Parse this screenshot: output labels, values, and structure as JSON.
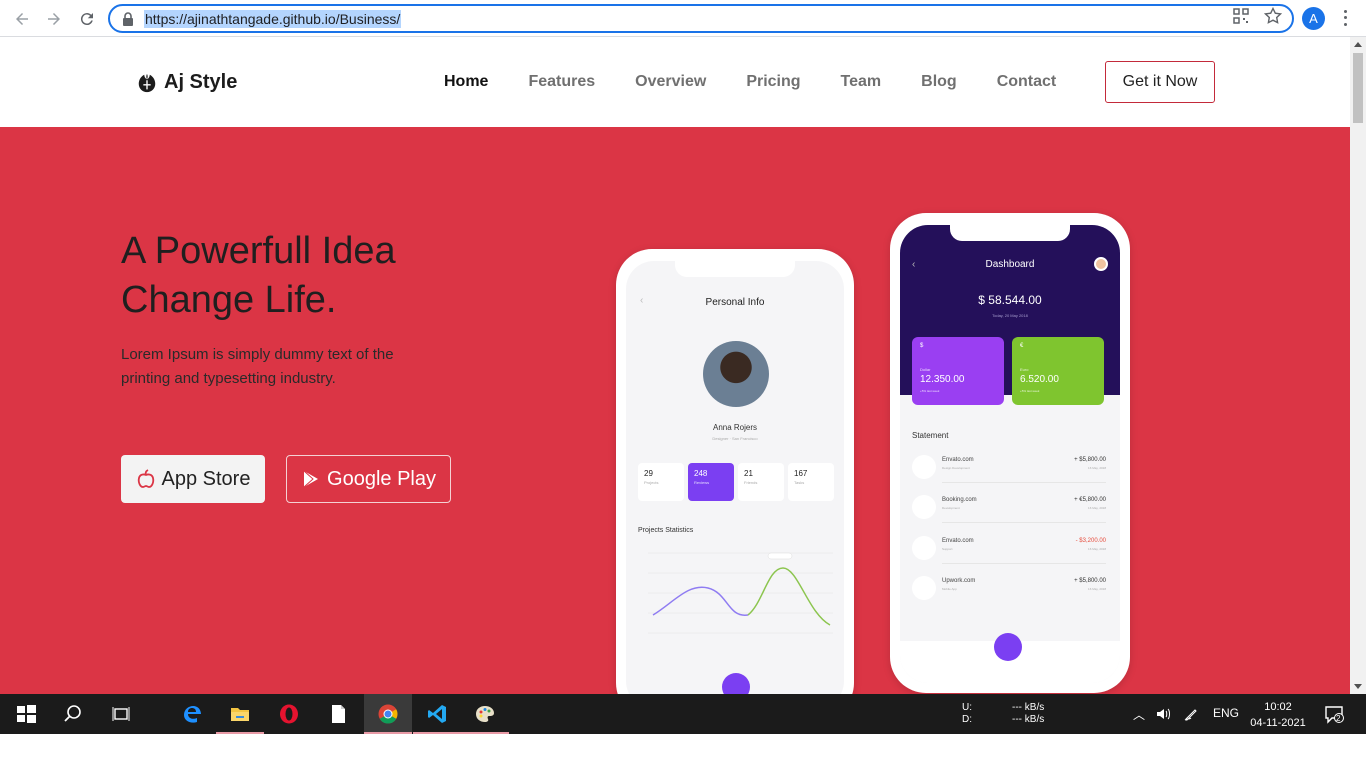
{
  "browser": {
    "url": "https://ajinathtangade.github.io/Business/",
    "profile_initial": "A"
  },
  "site": {
    "brand": "Aj Style",
    "menu": [
      "Home",
      "Features",
      "Overview",
      "Pricing",
      "Team",
      "Blog",
      "Contact"
    ],
    "active_menu": "Home",
    "cta": "Get it Now",
    "hero": {
      "title": "A Powerfull Idea Change Life.",
      "lead": "Lorem Ipsum is simply dummy text of the printing and typesetting industry.",
      "app_store": "App Store",
      "google_play": "Google Play",
      "background": "#db3545"
    }
  },
  "phone1": {
    "title": "Personal Info",
    "name": "Anna Rojers",
    "role": "Designer · San Francisco",
    "stats": [
      {
        "value": "29",
        "label": "Projects"
      },
      {
        "value": "248",
        "label": "Reviews"
      },
      {
        "value": "21",
        "label": "Friends"
      },
      {
        "value": "167",
        "label": "Tasks"
      }
    ],
    "section": "Projects Statistics"
  },
  "phone2": {
    "title": "Dashboard",
    "balance": "$ 58.544.00",
    "date": "Today, 20 May 2018",
    "cards": [
      {
        "currency": "$",
        "label": "Dollar",
        "amount": "12.350.00",
        "note": "+5% last week"
      },
      {
        "currency": "€",
        "label": "Euro",
        "amount": "6.520.00",
        "note": "+5% last week"
      }
    ],
    "statement_title": "Statement",
    "statement": [
      {
        "name": "Envato.com",
        "sub": "Design Development",
        "amount": "+ $5,800.00",
        "date": "16 May, 2018",
        "negative": false
      },
      {
        "name": "Booking.com",
        "sub": "Development",
        "amount": "+ €5,800.00",
        "date": "16 May, 2018",
        "negative": false
      },
      {
        "name": "Envato.com",
        "sub": "Support",
        "amount": "- $3,200.00",
        "date": "16 May, 2018",
        "negative": true
      },
      {
        "name": "Upwork.com",
        "sub": "Mobile App",
        "amount": "+ $5,800.00",
        "date": "16 May, 2018",
        "negative": false
      }
    ]
  },
  "taskbar": {
    "net_up_label": "U:",
    "net_down_label": "D:",
    "net_up": "--- kB/s",
    "net_down": "--- kB/s",
    "lang": "ENG",
    "time": "10:02",
    "date": "04-11-2021",
    "notifications": "2"
  }
}
